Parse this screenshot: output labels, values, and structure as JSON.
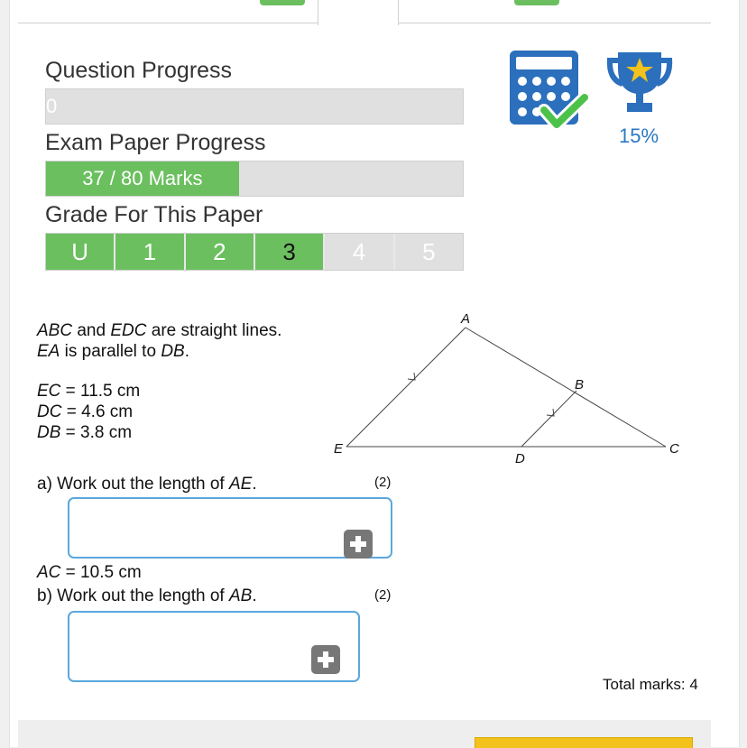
{
  "progress": {
    "question_label": "Question Progress",
    "question_value_text": "0",
    "question_fraction": 0,
    "exam_label": "Exam Paper Progress",
    "exam_value_text": "37 / 80 Marks",
    "exam_fraction": 0.4625,
    "grade_label": "Grade For This Paper",
    "grades": [
      "U",
      "1",
      "2",
      "3",
      "4",
      "5"
    ],
    "current_grade_index": 3
  },
  "badges": {
    "calculator_icon": "calculator-check-icon",
    "trophy_icon": "trophy-star-icon",
    "trophy_percent": "15%"
  },
  "question": {
    "intro_line1_parts": [
      "ABC",
      " and ",
      "EDC",
      " are straight lines."
    ],
    "intro_line2_parts": [
      "EA",
      " is parallel to ",
      "DB",
      "."
    ],
    "given": [
      {
        "var": "EC",
        "rest": " = 11.5 cm"
      },
      {
        "var": "DC",
        "rest": " = 4.6 cm"
      },
      {
        "var": "DB",
        "rest": " = 3.8 cm"
      }
    ],
    "diagram_labels": {
      "A": "A",
      "B": "B",
      "C": "C",
      "D": "D",
      "E": "E"
    },
    "part_a": {
      "prefix": "a)  Work out the length of ",
      "var": "AE",
      "suffix": ".",
      "marks": "(2)"
    },
    "extra_given": {
      "var": "AC",
      "rest": " = 10.5 cm"
    },
    "part_b": {
      "prefix": "b)  Work out the length of ",
      "var": "AB",
      "suffix": ".",
      "marks": "(2)"
    },
    "total": "Total marks: 4"
  },
  "colors": {
    "green": "#6bbf5f",
    "blue": "#2b78c2",
    "input_border": "#5aa8dd",
    "yellow": "#f3c21b"
  }
}
